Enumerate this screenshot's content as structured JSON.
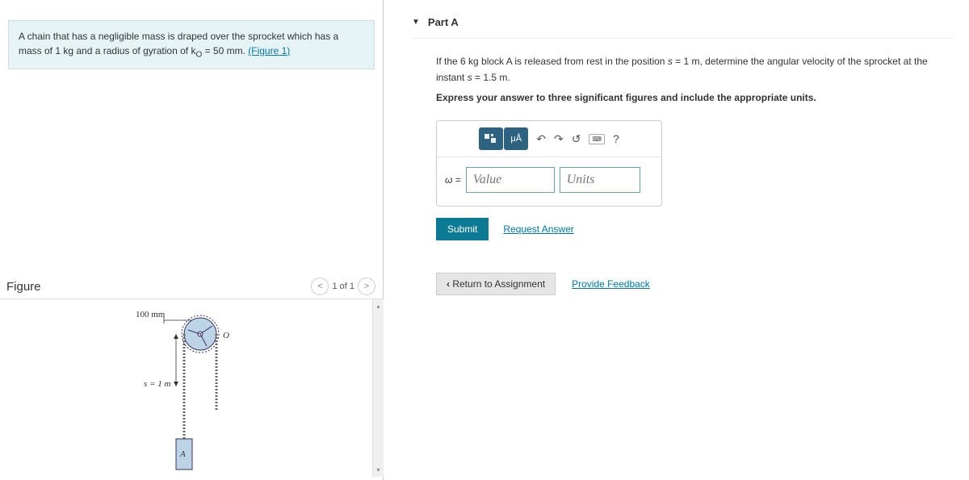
{
  "problem": {
    "text_before_link": "A chain that has a negligible mass is draped over the sprocket which has a mass of 1 kg and a radius of gyration of k",
    "subscript": "O",
    "text_mid": " = 50 mm. ",
    "link": "(Figure 1)"
  },
  "figure": {
    "title": "Figure",
    "counter": "1 of 1",
    "label_100mm": "100 mm",
    "label_o": "O",
    "label_s": "s = 1 m",
    "label_a": "A"
  },
  "part": {
    "label": "Part A",
    "q_prefix": "If the 6 kg block A is released from rest in the position ",
    "q_s1_var": "s",
    "q_s1_eq": " = 1 m, determine the angular velocity of the sprocket at the instant ",
    "q_s2_var": "s",
    "q_s2_eq": " = 1.5 m.",
    "hint": "Express your answer to three significant figures and include the appropriate units."
  },
  "toolbar": {
    "templates_icon": "□",
    "mu_a": "μÅ",
    "undo": "↶",
    "redo": "↷",
    "reset": "↺",
    "keyboard": "⌨",
    "help": "?"
  },
  "answer": {
    "var": "ω",
    "eq": " = ",
    "value_placeholder": "Value",
    "units_placeholder": "Units"
  },
  "buttons": {
    "submit": "Submit",
    "request": "Request Answer",
    "return": "Return to Assignment",
    "feedback": "Provide Feedback"
  }
}
